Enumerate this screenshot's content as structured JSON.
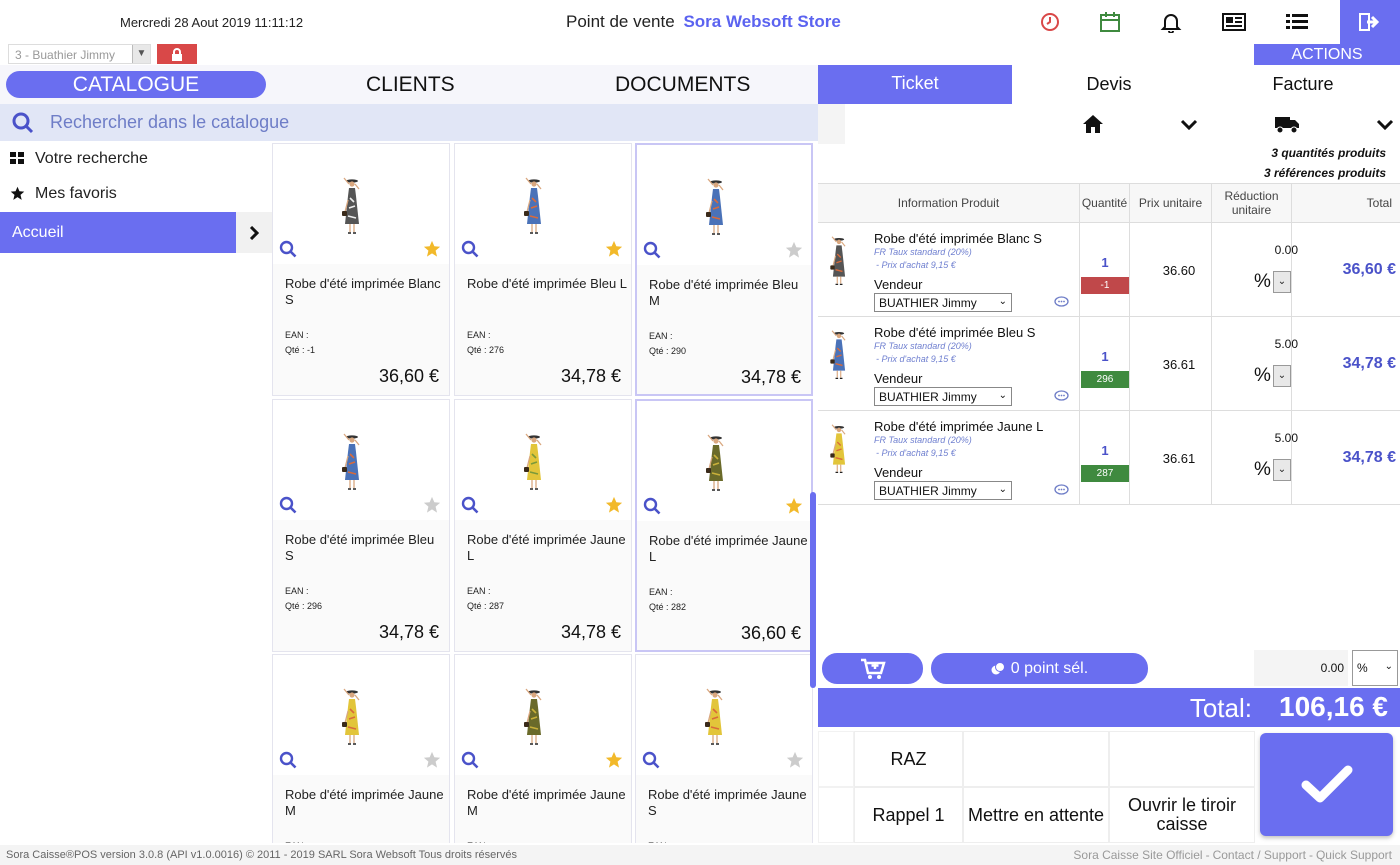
{
  "header": {
    "datetime": "Mercredi 28 Aout 2019 11:11:12",
    "store_prefix": "Point de vente",
    "store_name": "Sora Websoft Store",
    "user": "3 - Buathier Jimmy",
    "actions_label": "ACTIONS",
    "icons": [
      "clock-icon",
      "calendar-icon",
      "bell-icon",
      "newspaper-icon",
      "list-icon",
      "exit-icon"
    ]
  },
  "nav": {
    "tabs": [
      "CATALOGUE",
      "CLIENTS",
      "DOCUMENTS"
    ],
    "active": "CATALOGUE"
  },
  "search": {
    "placeholder": "Rechercher dans le catalogue"
  },
  "sidebar": {
    "items": [
      {
        "label": "Votre recherche",
        "icon": "grid-icon"
      },
      {
        "label": "Mes favoris",
        "icon": "star-icon"
      },
      {
        "label": "Accueil",
        "icon": "chevron-right-icon"
      }
    ]
  },
  "products": [
    {
      "name": "Robe d'été imprimée Blanc S",
      "ean": "EAN :",
      "qty": "Qté : -1",
      "price": "36,60 €",
      "favorite": true,
      "dress": "#555555",
      "accent": "#eeeeee"
    },
    {
      "name": "Robe d'été imprimée Bleu L",
      "ean": "EAN :",
      "qty": "Qté : 276",
      "price": "34,78 €",
      "favorite": true,
      "dress": "#4a72b8",
      "accent": "#d96a3a"
    },
    {
      "name": "Robe d'été imprimée Bleu M",
      "ean": "EAN :",
      "qty": "Qté : 290",
      "price": "34,78 €",
      "favorite": false,
      "dress": "#4a72b8",
      "accent": "#d96a3a"
    },
    {
      "name": "Robe d'été imprimée Bleu S",
      "ean": "EAN :",
      "qty": "Qté : 296",
      "price": "34,78 €",
      "favorite": false,
      "dress": "#4a72b8",
      "accent": "#d96a3a"
    },
    {
      "name": "Robe d'été imprimée Jaune L",
      "ean": "EAN :",
      "qty": "Qté : 287",
      "price": "34,78 €",
      "favorite": true,
      "dress": "#e2c53a",
      "accent": "#7a9a3a"
    },
    {
      "name": "Robe d'été imprimée Jaune L",
      "ean": "EAN :",
      "qty": "Qté : 282",
      "price": "36,60 €",
      "favorite": true,
      "dress": "#6a6a2a",
      "accent": "#c9b03a"
    },
    {
      "name": "Robe d'été imprimée Jaune M",
      "ean": "EAN :",
      "qty": "",
      "price": "",
      "favorite": false,
      "dress": "#e2c53a",
      "accent": "#d96a3a"
    },
    {
      "name": "Robe d'été imprimée Jaune M",
      "ean": "EAN :",
      "qty": "",
      "price": "",
      "favorite": true,
      "dress": "#6a6a2a",
      "accent": "#c9b03a"
    },
    {
      "name": "Robe d'été imprimée Jaune S",
      "ean": "EAN :",
      "qty": "",
      "price": "",
      "favorite": false,
      "dress": "#e2c53a",
      "accent": "#d96a3a"
    }
  ],
  "doc_tabs": [
    "Ticket",
    "Devis",
    "Facture"
  ],
  "summary": {
    "quantities": "3  quantités produits",
    "references": "3  références produits"
  },
  "table": {
    "headers": [
      "Information Produit",
      "Quantité",
      "Prix unitaire",
      "Réduction unitaire",
      "Total"
    ],
    "rows": [
      {
        "name": "Robe d'été imprimée Blanc S",
        "tax": "FR Taux standard (20%)",
        "buy": "- Prix d'achat 9,15 €",
        "seller_label": "Vendeur",
        "seller": "BUATHIER Jimmy",
        "qty": "1",
        "stock": "-1",
        "stock_color": "#c0484a",
        "unit": "36.60",
        "reduction": "0.00",
        "reduction_unit": "%",
        "total": "36,60 €",
        "dress": "#555555"
      },
      {
        "name": "Robe d'été imprimée Bleu S",
        "tax": "FR Taux standard (20%)",
        "buy": "- Prix d'achat 9,15 €",
        "seller_label": "Vendeur",
        "seller": "BUATHIER Jimmy",
        "qty": "1",
        "stock": "296",
        "stock_color": "#3f8a3f",
        "unit": "36.61",
        "reduction": "5.00",
        "reduction_unit": "%",
        "total": "34,78 €",
        "dress": "#4a72b8"
      },
      {
        "name": "Robe d'été imprimée Jaune L",
        "tax": "FR Taux standard (20%)",
        "buy": "- Prix d'achat 9,15 €",
        "seller_label": "Vendeur",
        "seller": "BUATHIER Jimmy",
        "qty": "1",
        "stock": "287",
        "stock_color": "#3f8a3f",
        "unit": "36.61",
        "reduction": "5.00",
        "reduction_unit": "%",
        "total": "34,78 €",
        "dress": "#e2c53a"
      }
    ]
  },
  "bottom": {
    "points_label": "0 point sél.",
    "discount_value": "0.00",
    "discount_unit": "%",
    "total_label": "Total:",
    "total_value": "106,16 €",
    "buttons": {
      "raz": "RAZ",
      "rappel": "Rappel 1",
      "hold": "Mettre en attente",
      "drawer": "Ouvrir le tiroir caisse"
    }
  },
  "footer": {
    "left": "Sora Caisse®POS version 3.0.8 (API v1.0.0016) © 2011 - 2019 SARL Sora Websoft Tous droits réservés",
    "links": [
      "Sora Caisse Site Officiel",
      "Contact / Support",
      "Quick Support"
    ]
  },
  "colors": {
    "accent": "#6a6ef0",
    "search_bg": "#e1e6f6",
    "star_active": "#f2b92a",
    "star_inactive": "#cccccc",
    "danger": "#d94848"
  }
}
